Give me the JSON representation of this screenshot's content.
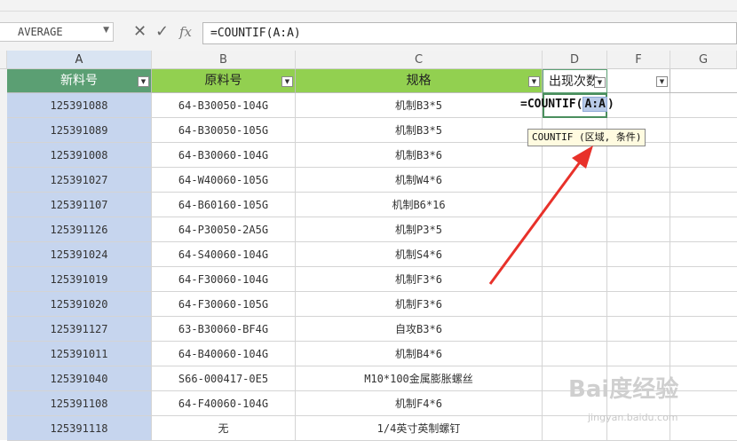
{
  "formula_bar": {
    "name_box": "AVERAGE",
    "cancel_icon": "close-icon",
    "enter_icon": "check-icon",
    "fx_label": "fx",
    "formula": "=COUNTIF(A:A)"
  },
  "columns": {
    "A": "A",
    "B": "B",
    "C": "C",
    "D": "D",
    "F": "F",
    "G": "G"
  },
  "headers": {
    "a": "新料号",
    "b": "原料号",
    "c": "规格",
    "d": "出现次数"
  },
  "rows": [
    {
      "a": "125391088",
      "b": "64-B30050-104G",
      "c": "机制B3*5"
    },
    {
      "a": "125391089",
      "b": "64-B30050-105G",
      "c": "机制B3*5"
    },
    {
      "a": "125391008",
      "b": "64-B30060-104G",
      "c": "机制B3*6"
    },
    {
      "a": "125391027",
      "b": "64-W40060-105G",
      "c": "机制W4*6"
    },
    {
      "a": "125391107",
      "b": "64-B60160-105G",
      "c": "机制B6*16"
    },
    {
      "a": "125391126",
      "b": "64-P30050-2A5G",
      "c": "机制P3*5"
    },
    {
      "a": "125391024",
      "b": "64-S40060-104G",
      "c": "机制S4*6"
    },
    {
      "a": "125391019",
      "b": "64-F30060-104G",
      "c": "机制F3*6"
    },
    {
      "a": "125391020",
      "b": "64-F30060-105G",
      "c": "机制F3*6"
    },
    {
      "a": "125391127",
      "b": "63-B30060-BF4G",
      "c": "自攻B3*6"
    },
    {
      "a": "125391011",
      "b": "64-B40060-104G",
      "c": "机制B4*6"
    },
    {
      "a": "125391040",
      "b": "S66-000417-0E5",
      "c": "M10*100金属膨胀螺丝"
    },
    {
      "a": "125391108",
      "b": "64-F40060-104G",
      "c": "机制F4*6"
    },
    {
      "a": "125391118",
      "b": "无",
      "c": "1/4英寸英制螺钉"
    }
  ],
  "edit": {
    "prefix": "=COUNTIF(",
    "ref": "A:A",
    "suffix": ")"
  },
  "tooltip": "COUNTIF (区域, 条件)",
  "watermark": {
    "main": "Bai度经验",
    "sub": "jingyan.baidu.com"
  },
  "colors": {
    "header_green": "#92d050",
    "header_teal": "#5b9f73",
    "selection_blue": "#c6d5ee",
    "annotation_arrow": "#e8312a"
  }
}
